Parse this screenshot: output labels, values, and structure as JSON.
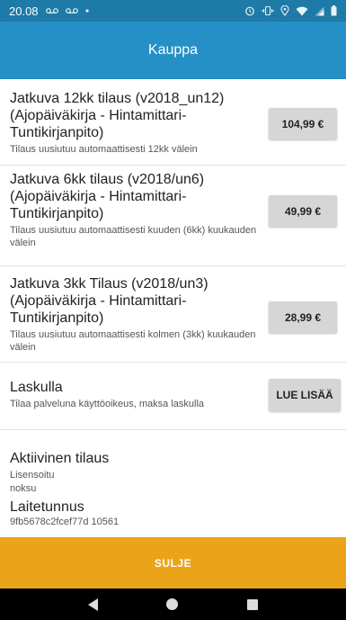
{
  "status_bar": {
    "time": "20.08",
    "left_icons": [
      "voicemail-icon",
      "voicemail-icon",
      "dot-icon"
    ],
    "right_icons": [
      "alarm-icon",
      "vibrate-icon",
      "location-icon",
      "wifi-icon",
      "signal-icon",
      "battery-icon"
    ]
  },
  "app_bar": {
    "title": "Kauppa"
  },
  "products": [
    {
      "title": "Jatkuva 12kk tilaus (v2018_un12) (Ajopäiväkirja - Hintamittari-Tuntikirjanpito)",
      "desc": "Tilaus uusiutuu automaattisesti 12kk välein",
      "price": "104,99 €"
    },
    {
      "title": "Jatkuva 6kk tilaus (v2018/un6) (Ajopäiväkirja - Hintamittari-Tuntikirjanpito)",
      "desc": "Tilaus uusiutuu automaattisesti kuuden (6kk) kuukauden välein",
      "price": "49,99 €"
    },
    {
      "title": "Jatkuva 3kk Tilaus (v2018/un3) (Ajopäiväkirja - Hintamittari-Tuntikirjanpito)",
      "desc": "Tilaus uusiutuu automaattisesti kolmen (3kk) kuukauden välein",
      "price": "28,99 €"
    }
  ],
  "invoice": {
    "title": "Laskulla",
    "desc": "Tilaa palveluna käyttöoikeus, maksa laskulla",
    "button": "LUE LISÄÄ"
  },
  "active": {
    "title": "Aktiivinen tilaus",
    "license": "Lisensoitu",
    "user": "noksu",
    "device_title": "Laitetunnus",
    "device_id": "9fb5678c2fcef77d 10561"
  },
  "footer": {
    "close_label": "SULJE"
  },
  "colors": {
    "status_bar": "#1e7aa6",
    "app_bar": "#2490c6",
    "close_bar": "#eba31a",
    "button_bg": "#d6d6d6"
  }
}
